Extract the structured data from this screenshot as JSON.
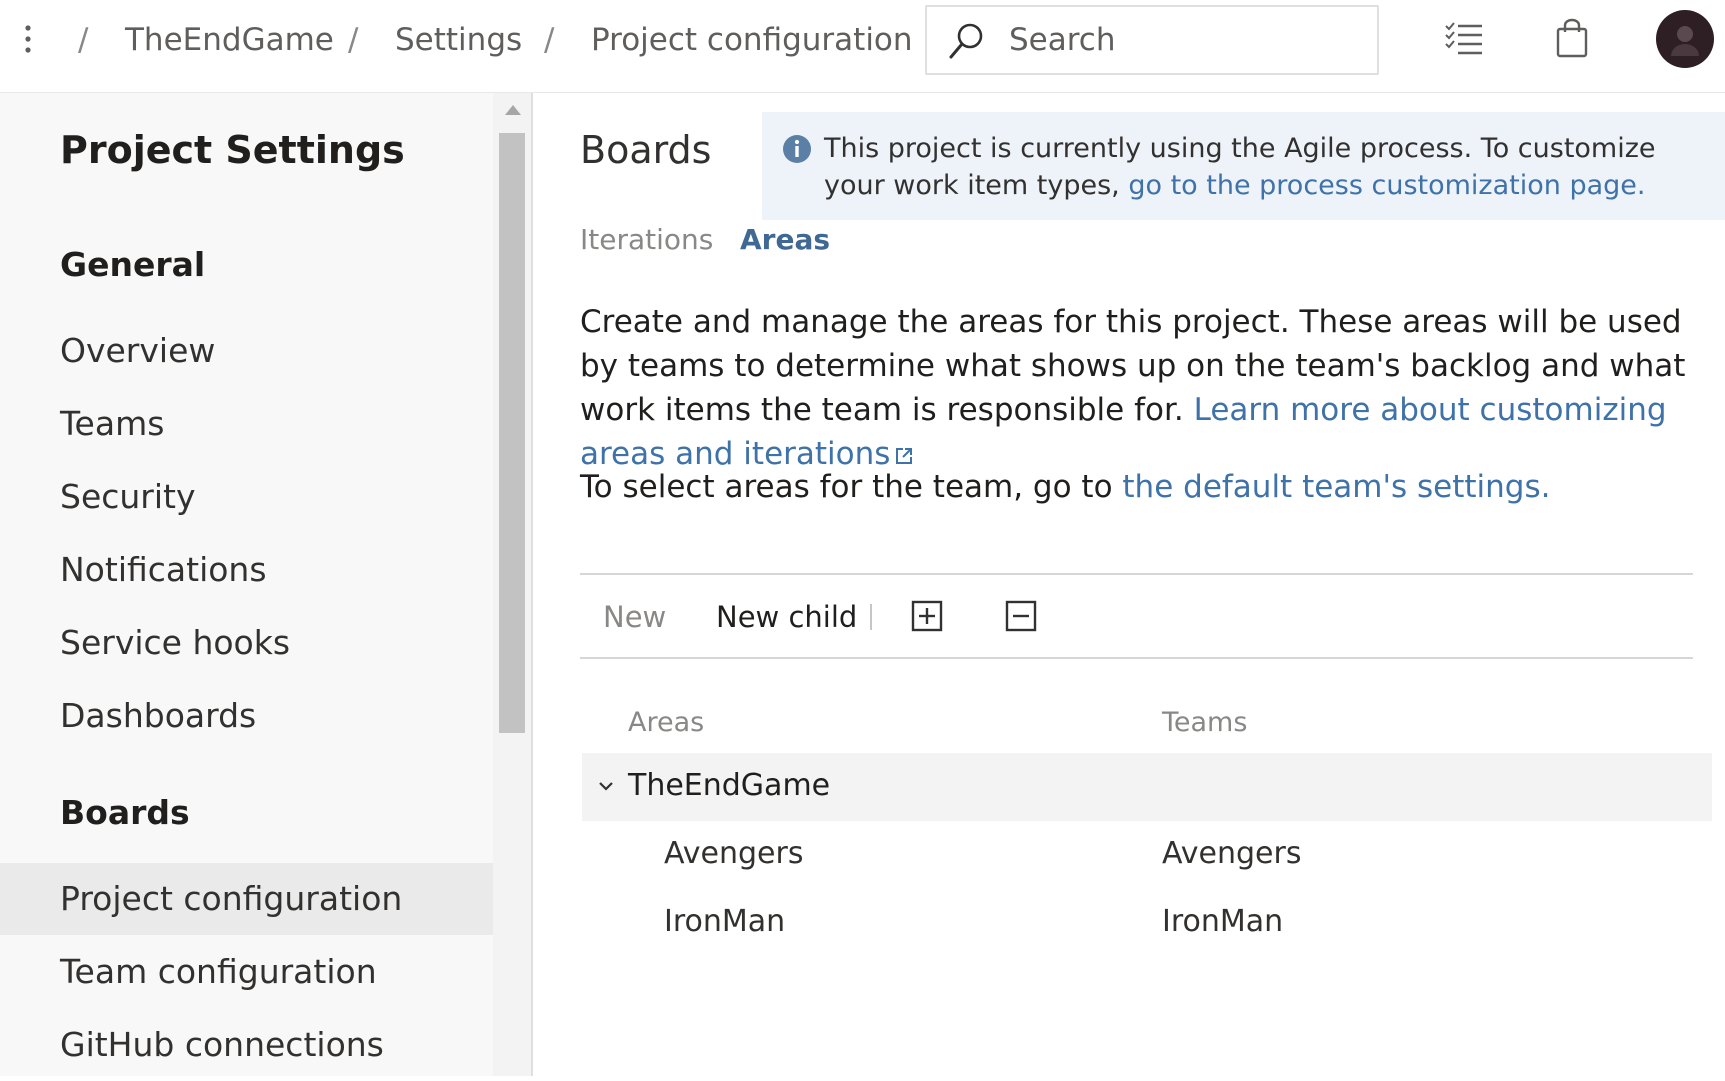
{
  "breadcrumb": {
    "items": [
      "TheEndGame",
      "Settings",
      "Project configuration"
    ],
    "separator": "/"
  },
  "search": {
    "placeholder": "Search"
  },
  "toolbar_icons": [
    "more-icon",
    "task-list-icon",
    "shopping-bag-icon",
    "avatar"
  ],
  "sidebar": {
    "title": "Project Settings",
    "sections": [
      {
        "heading": "General",
        "items": [
          "Overview",
          "Teams",
          "Security",
          "Notifications",
          "Service hooks",
          "Dashboards"
        ]
      },
      {
        "heading": "Boards",
        "items": [
          "Project configuration",
          "Team configuration",
          "GitHub connections"
        ]
      }
    ],
    "selected_item": "Project configuration"
  },
  "main": {
    "title": "Boards",
    "info_banner": {
      "text": "This project is currently using the Agile process. To customize your work item types, ",
      "link": "go to the process customization page."
    },
    "tabs": [
      {
        "label": "Iterations",
        "active": false
      },
      {
        "label": "Areas",
        "active": true
      }
    ],
    "description": {
      "text": "Create and manage the areas for this project. These areas will be used by teams to determine what shows up on the team's backlog and what work items the team is responsible for. ",
      "link": "Learn more about customizing areas and iterations"
    },
    "select_hint": {
      "text": "To select areas for the team, go to ",
      "link": "the default team's settings."
    },
    "actions": {
      "new_label": "New",
      "new_child_label": "New child",
      "icons": [
        "expand-all-icon",
        "collapse-all-icon"
      ]
    },
    "table": {
      "columns": [
        "Areas",
        "Teams"
      ],
      "root": {
        "area": "TheEndGame",
        "team": ""
      },
      "children": [
        {
          "area": "Avengers",
          "team": "Avengers"
        },
        {
          "area": "IronMan",
          "team": "IronMan"
        }
      ]
    }
  },
  "colors": {
    "accent": "#3f72a8",
    "active_tab": "#3f6895",
    "banner_bg": "#eef3f9",
    "info_icon": "#5c7fa6",
    "sidebar_bg": "#f8f8f8",
    "selected_bg": "#eaeaea"
  }
}
